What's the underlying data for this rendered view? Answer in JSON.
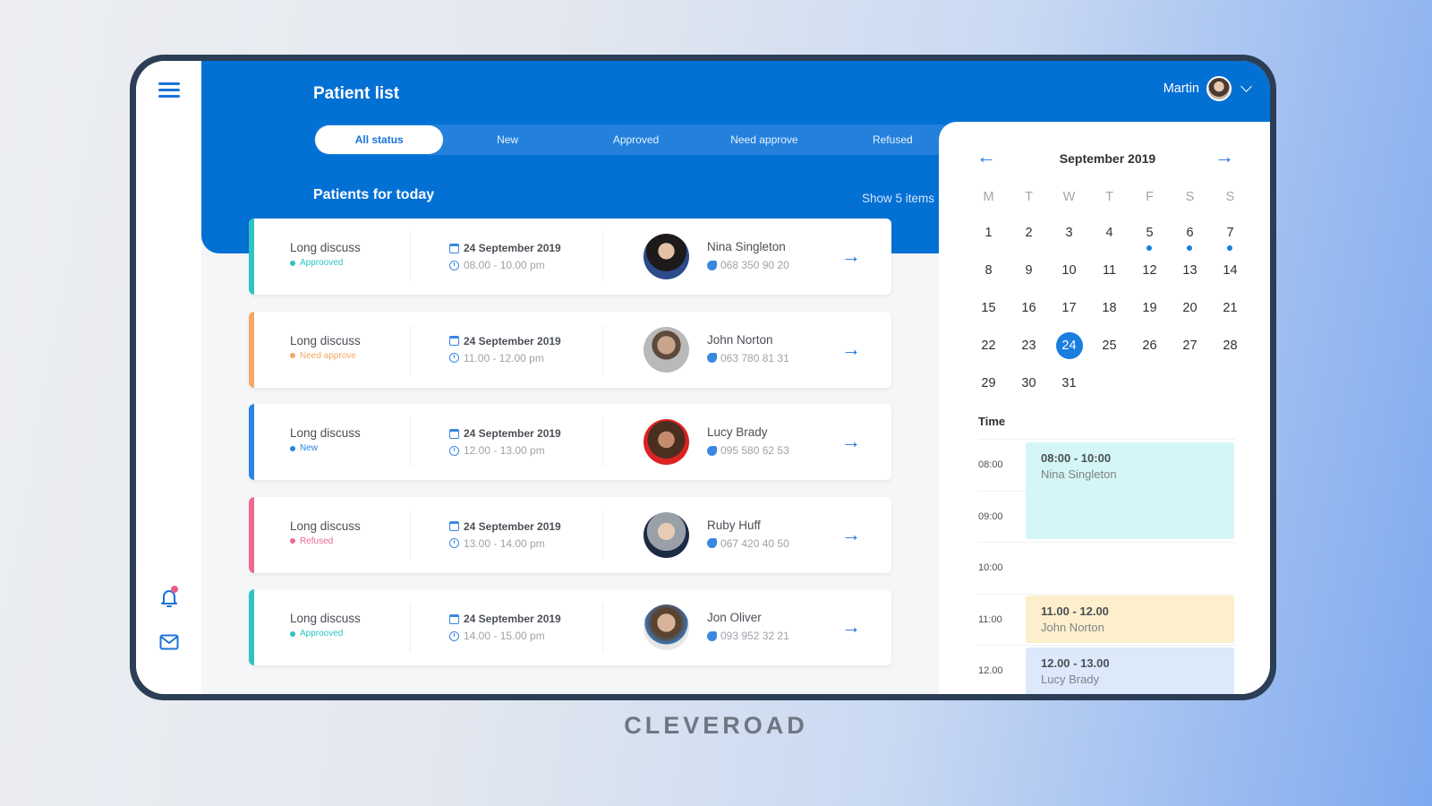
{
  "header": {
    "title": "Patient list",
    "user_name": "Martin"
  },
  "status_tabs": [
    {
      "label": "All status",
      "active": true
    },
    {
      "label": "New",
      "active": false
    },
    {
      "label": "Approved",
      "active": false
    },
    {
      "label": "Need approve",
      "active": false
    },
    {
      "label": "Refused",
      "active": false
    }
  ],
  "section": {
    "title": "Patients for today",
    "show_items": "Show 5 items"
  },
  "status_colors": {
    "Approoved": "#2ec5c0",
    "Need approve": "#f5a863",
    "New": "#2a84e4",
    "Refused": "#ec6a8f"
  },
  "patients": [
    {
      "visit": "Long discuss",
      "status": "Approoved",
      "date": "24 September 2019",
      "time": "08.00 - 10.00 pm",
      "name": "Nina Singleton",
      "phone": "068 350 90 20",
      "accent": "#2ec5c0",
      "status_color": "#2ec5c0"
    },
    {
      "visit": "Long discuss",
      "status": "Need approve",
      "date": "24 September 2019",
      "time": "11.00 - 12.00 pm",
      "name": "John Norton",
      "phone": "063 780 81 31",
      "accent": "#f5a863",
      "status_color": "#f5a863"
    },
    {
      "visit": "Long discuss",
      "status": "New",
      "date": "24 September 2019",
      "time": "12.00 - 13.00 pm",
      "name": "Lucy Brady",
      "phone": "095 580 62 53",
      "accent": "#2a84e4",
      "status_color": "#2a84e4"
    },
    {
      "visit": "Long discuss",
      "status": "Refused",
      "date": "24 September 2019",
      "time": "13.00 - 14.00 pm",
      "name": "Ruby Huff",
      "phone": "067 420 40 50",
      "accent": "#ec6a8f",
      "status_color": "#ec6a8f"
    },
    {
      "visit": "Long discuss",
      "status": "Approoved",
      "date": "24 September 2019",
      "time": "14.00 - 15.00 pm",
      "name": "Jon Oliver",
      "phone": "093 952 32 21",
      "accent": "#2ec5c0",
      "status_color": "#2ec5c0"
    }
  ],
  "calendar": {
    "month_label": "September  2019",
    "weekdays": [
      "M",
      "T",
      "W",
      "T",
      "F",
      "S",
      "S"
    ],
    "days": [
      1,
      2,
      3,
      4,
      5,
      6,
      7,
      8,
      9,
      10,
      11,
      12,
      13,
      14,
      15,
      16,
      17,
      18,
      19,
      20,
      21,
      22,
      23,
      24,
      25,
      26,
      27,
      28,
      29,
      30,
      31
    ],
    "selected_day": 24,
    "days_with_events": [
      5,
      6,
      7
    ]
  },
  "schedule": {
    "title": "Time",
    "hours": [
      "08:00",
      "09:00",
      "10:00",
      "11:00",
      "12.00"
    ],
    "events": [
      {
        "time": "08:00 - 10:00",
        "name": "Nina Singleton",
        "color": "#d5f6f6"
      },
      {
        "time": "11.00 - 12.00",
        "name": "John Norton",
        "color": "#fdefcb"
      },
      {
        "time": "12.00 - 13.00",
        "name": "Lucy Brady",
        "color": "#dce9fb"
      }
    ]
  },
  "brand": "CLEVEROAD"
}
